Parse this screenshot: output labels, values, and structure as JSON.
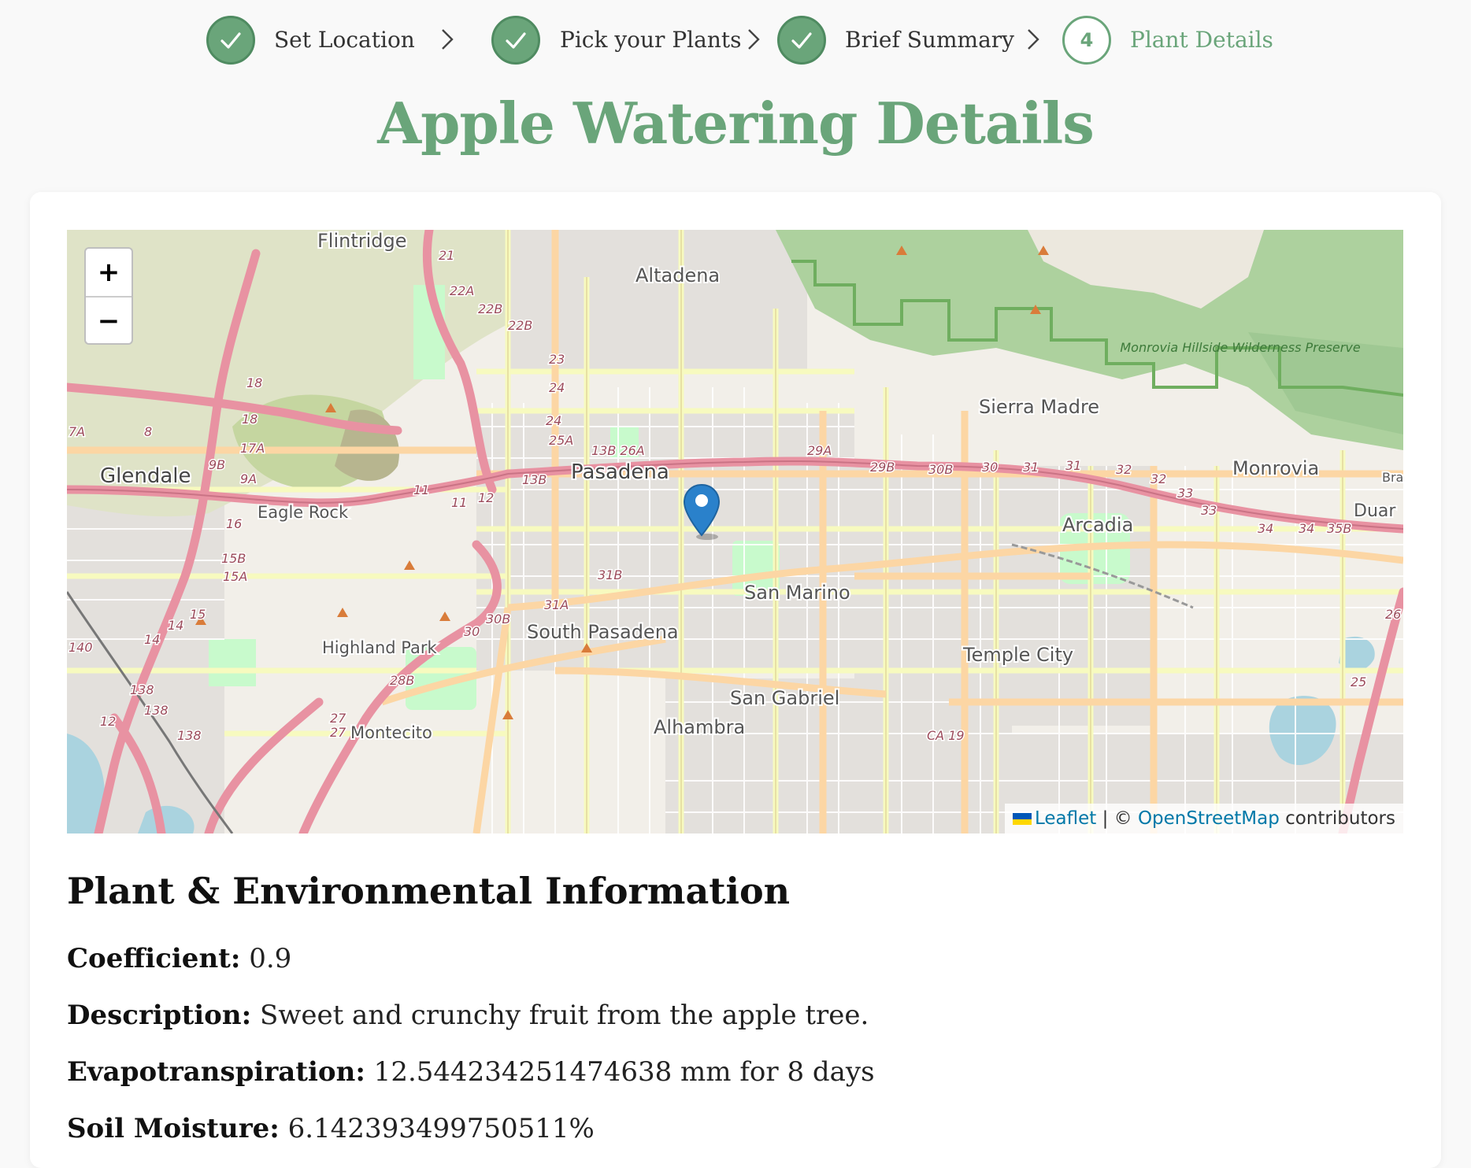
{
  "stepper": {
    "steps": [
      {
        "label": "Set Location",
        "status": "done",
        "icon": "checkmark-icon"
      },
      {
        "label": "Pick your Plants",
        "status": "done",
        "icon": "checkmark-icon"
      },
      {
        "label": "Brief Summary",
        "status": "done",
        "icon": "checkmark-icon"
      },
      {
        "label": "Plant Details",
        "status": "active",
        "number": "4"
      }
    ],
    "separator_icon": "chevron-right-icon"
  },
  "page": {
    "title": "Apple Watering Details"
  },
  "map": {
    "zoom_in": "+",
    "zoom_out": "−",
    "marker_icon": "map-pin-icon",
    "places": [
      "Flintridge",
      "Altadena",
      "Glendale",
      "Pasadena",
      "Eagle Rock",
      "Sierra Madre",
      "Monrovia",
      "Arcadia",
      "San Marino",
      "South Pasadena",
      "Highland Park",
      "Temple City",
      "San Gabriel",
      "Alhambra",
      "Montecito",
      "Duar",
      "Bra",
      "Monrovia Hillside Wilderness Preserve"
    ],
    "highway_labels": [
      "21",
      "22A",
      "22B",
      "22B",
      "23",
      "24",
      "24",
      "25A",
      "13B 26A",
      "29A",
      "29B",
      "30B",
      "30",
      "31",
      "31",
      "32",
      "32",
      "33",
      "33",
      "34",
      "34",
      "35B",
      "13B",
      "11",
      "11",
      "12",
      "9B",
      "9A",
      "8",
      "7A",
      "18",
      "18",
      "17A",
      "16",
      "15B",
      "15A",
      "15",
      "14",
      "14",
      "140",
      "138",
      "138",
      "138",
      "12",
      "31B",
      "31A",
      "30B",
      "30",
      "28B",
      "27",
      "27",
      "26",
      "25",
      "CA 19"
    ],
    "attribution": {
      "leaflet": "Leaflet",
      "separator": " | © ",
      "osm": "OpenStreetMap",
      "suffix": " contributors"
    },
    "colors": {
      "land": "#f2efe9",
      "forest": "#add19e",
      "highway": "#e892a2",
      "major_road": "#fcd6a4",
      "minor_road": "#f7fabf",
      "park": "#c8facc",
      "water": "#aad3df"
    }
  },
  "info": {
    "heading": "Plant & Environmental Information",
    "rows": [
      {
        "key": "Coefficient:",
        "value": " 0.9"
      },
      {
        "key": "Description:",
        "value": " Sweet and crunchy fruit from the apple tree."
      },
      {
        "key": "Evapotranspiration:",
        "value": " 12.544234251474638 mm for 8 days"
      },
      {
        "key": "Soil Moisture:",
        "value": " 6.142393499750511%"
      }
    ]
  },
  "colors": {
    "accent": "#6aa57a",
    "accent_dark": "#4f8b61",
    "link": "#0078a8",
    "marker": "#2a81cb"
  }
}
